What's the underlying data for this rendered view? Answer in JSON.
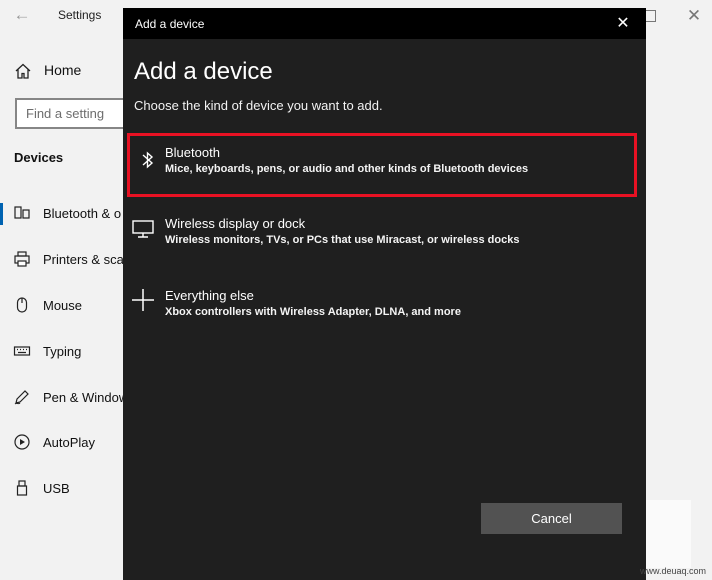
{
  "settings": {
    "title": "Settings",
    "home_label": "Home",
    "search_placeholder": "Find a setting",
    "section_label": "Devices",
    "nav_items": [
      {
        "label": "Bluetooth & o",
        "icon": "bluetooth-devices-icon",
        "selected": true
      },
      {
        "label": "Printers & sca",
        "icon": "printer-icon",
        "selected": false
      },
      {
        "label": "Mouse",
        "icon": "mouse-icon",
        "selected": false
      },
      {
        "label": "Typing",
        "icon": "keyboard-icon",
        "selected": false
      },
      {
        "label": "Pen & Window",
        "icon": "pen-icon",
        "selected": false
      },
      {
        "label": "AutoPlay",
        "icon": "autoplay-icon",
        "selected": false
      },
      {
        "label": "USB",
        "icon": "usb-icon",
        "selected": false
      }
    ]
  },
  "dialog": {
    "window_title": "Add a device",
    "heading": "Add a device",
    "subtitle": "Choose the kind of device you want to add.",
    "options": [
      {
        "title": "Bluetooth",
        "description": "Mice, keyboards, pens, or audio and other kinds of Bluetooth devices",
        "icon": "bluetooth-icon",
        "highlighted": true
      },
      {
        "title": "Wireless display or dock",
        "description": "Wireless monitors, TVs, or PCs that use Miracast, or wireless docks",
        "icon": "monitor-icon",
        "highlighted": false
      },
      {
        "title": "Everything else",
        "description": "Xbox controllers with Wireless Adapter, DLNA, and more",
        "icon": "plus-icon",
        "highlighted": false
      }
    ],
    "cancel_label": "Cancel",
    "highlight_color": "#e81123"
  },
  "watermark": "www.deuaq.com"
}
